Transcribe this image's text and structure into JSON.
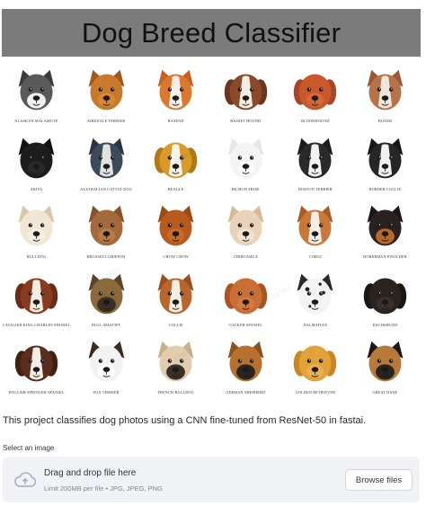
{
  "app": {
    "title": "Dog Breed Classifier"
  },
  "banner": {
    "watermark": "123RF",
    "dogs": [
      {
        "label": "Alaskan Malamute",
        "icon": "alaskan-malamute-icon",
        "colors": {
          "fur": "#5a5a5a",
          "face": "#f2f2f2",
          "ear": "#3c3c3c",
          "pattern": "mask"
        }
      },
      {
        "label": "Airedale Terrier",
        "icon": "airedale-terrier-icon",
        "colors": {
          "fur": "#c87a2a",
          "face": "#d68a38",
          "ear": "#a4581c",
          "pattern": "solid"
        }
      },
      {
        "label": "Basenji",
        "icon": "basenji-icon",
        "colors": {
          "fur": "#d9782e",
          "face": "#f4f0e8",
          "ear": "#c86222",
          "pattern": "blaze"
        }
      },
      {
        "label": "Basset Hound",
        "icon": "basset-hound-icon",
        "colors": {
          "fur": "#8a4a2a",
          "face": "#f4ede2",
          "ear": "#6a3620",
          "pattern": "blaze"
        }
      },
      {
        "label": "Bloodhound",
        "icon": "bloodhound-icon",
        "colors": {
          "fur": "#c9582a",
          "face": "#d9683a",
          "ear": "#a8442a",
          "pattern": "solid"
        }
      },
      {
        "label": "Boxer",
        "icon": "boxer-icon",
        "colors": {
          "fur": "#b87248",
          "face": "#efe7dc",
          "ear": "#9a5834",
          "pattern": "blaze"
        }
      },
      {
        "label": "Akita",
        "icon": "akita-icon",
        "colors": {
          "fur": "#1d1d1d",
          "face": "#2a2a2a",
          "ear": "#111111",
          "pattern": "solid"
        }
      },
      {
        "label": "Australian Cattle Dog",
        "icon": "australian-cattle-dog-icon",
        "colors": {
          "fur": "#3d4a5a",
          "face": "#e2e2e2",
          "ear": "#2a3440",
          "pattern": "blaze"
        }
      },
      {
        "label": "Beagle",
        "icon": "beagle-icon",
        "colors": {
          "fur": "#d99a2a",
          "face": "#f5f2ea",
          "ear": "#b27718",
          "pattern": "blaze"
        }
      },
      {
        "label": "Bichon Frise",
        "icon": "bichon-frise-icon",
        "colors": {
          "fur": "#f4f4f4",
          "face": "#ffffff",
          "ear": "#e6e6e6",
          "pattern": "solid"
        }
      },
      {
        "label": "Boston Terrier",
        "icon": "boston-terrier-icon",
        "colors": {
          "fur": "#2a2a2a",
          "face": "#f2f2f2",
          "ear": "#1c1c1c",
          "pattern": "blaze"
        }
      },
      {
        "label": "Border Collie",
        "icon": "border-collie-icon",
        "colors": {
          "fur": "#262626",
          "face": "#f0f0f0",
          "ear": "#181818",
          "pattern": "blaze"
        }
      },
      {
        "label": "Bulldog",
        "icon": "bulldog-icon",
        "colors": {
          "fur": "#f1e6d4",
          "face": "#f6efe2",
          "ear": "#d8c6a8",
          "pattern": "solid"
        }
      },
      {
        "label": "Brussels Griffon",
        "icon": "brussels-griffon-icon",
        "colors": {
          "fur": "#a46a3c",
          "face": "#b87c4a",
          "ear": "#84522c",
          "pattern": "solid"
        }
      },
      {
        "label": "Chow Chow",
        "icon": "chow-chow-icon",
        "colors": {
          "fur": "#b85a1e",
          "face": "#c86a2a",
          "ear": "#9c4a16",
          "pattern": "solid"
        }
      },
      {
        "label": "Chihuahua",
        "icon": "chihuahua-icon",
        "colors": {
          "fur": "#e8d2b8",
          "face": "#f2e4d2",
          "ear": "#d8b896",
          "pattern": "solid"
        }
      },
      {
        "label": "Corgi",
        "icon": "corgi-icon",
        "colors": {
          "fur": "#c97838",
          "face": "#f4eee4",
          "ear": "#aa5c26",
          "pattern": "blaze"
        }
      },
      {
        "label": "Doberman Pinscher",
        "icon": "doberman-pinscher-icon",
        "colors": {
          "fur": "#2a2220",
          "face": "#b8682a",
          "ear": "#1c1614",
          "pattern": "mask"
        }
      },
      {
        "label": "Cavalier King Charles Spaniel",
        "icon": "cavalier-king-charles-spaniel-icon",
        "colors": {
          "fur": "#8a3a1e",
          "face": "#f4ede2",
          "ear": "#6a2a14",
          "pattern": "blaze"
        }
      },
      {
        "label": "Bull Mastiff",
        "icon": "bull-mastiff-icon",
        "colors": {
          "fur": "#8a6a3a",
          "face": "#3a3028",
          "ear": "#5a4428",
          "pattern": "mask"
        }
      },
      {
        "label": "Collie",
        "icon": "collie-icon",
        "colors": {
          "fur": "#b8662e",
          "face": "#f4ede2",
          "ear": "#9a4e1e",
          "pattern": "blaze"
        }
      },
      {
        "label": "Cocker Spaniel",
        "icon": "cocker-spaniel-icon",
        "colors": {
          "fur": "#c96e34",
          "face": "#d47c40",
          "ear": "#aa5424",
          "pattern": "solid"
        }
      },
      {
        "label": "Dalmatian",
        "icon": "dalmatian-icon",
        "colors": {
          "fur": "#f4f4f4",
          "face": "#ffffff",
          "ear": "#2a2a2a",
          "pattern": "spots"
        }
      },
      {
        "label": "Dachshund",
        "icon": "dachshund-icon",
        "colors": {
          "fur": "#2a2420",
          "face": "#3a302a",
          "ear": "#1a1614",
          "pattern": "solid"
        }
      },
      {
        "label": "English Springer Spaniel",
        "icon": "english-springer-spaniel-icon",
        "colors": {
          "fur": "#5a2e1e",
          "face": "#f4ede2",
          "ear": "#42200f",
          "pattern": "blaze"
        }
      },
      {
        "label": "Fox Terrier",
        "icon": "fox-terrier-icon",
        "colors": {
          "fur": "#f2f2f2",
          "face": "#ffffff",
          "ear": "#3a2a20",
          "pattern": "solid"
        }
      },
      {
        "label": "French Bulldog",
        "icon": "french-bulldog-icon",
        "colors": {
          "fur": "#e2ccae",
          "face": "#3a3028",
          "ear": "#c8ae8a",
          "pattern": "mask"
        }
      },
      {
        "label": "German Shepherd",
        "icon": "german-shepherd-icon",
        "colors": {
          "fur": "#b8702e",
          "face": "#2a2420",
          "ear": "#8a5220",
          "pattern": "mask"
        }
      },
      {
        "label": "Golden Retriever",
        "icon": "golden-retriever-icon",
        "colors": {
          "fur": "#e2a23a",
          "face": "#eab052",
          "ear": "#c8861e",
          "pattern": "solid"
        }
      },
      {
        "label": "Great Dane",
        "icon": "great-dane-icon",
        "colors": {
          "fur": "#b87a3a",
          "face": "#2a2420",
          "ear": "#1c1614",
          "pattern": "mask"
        }
      }
    ]
  },
  "description": "This project classifies dog photos using a CNN fine-tuned from ResNet-50 in fastai.",
  "uploader": {
    "label": "Select an image",
    "dropzone_title": "Drag and drop file here",
    "dropzone_hint": "Limit 200MB per file • JPG, JPEG, PNG",
    "browse_label": "Browse files",
    "icon": "cloud-upload-icon"
  },
  "colors": {
    "title_bar": "#7b7b7b",
    "dropzone_bg": "#f0f2f6",
    "text": "#262730"
  }
}
